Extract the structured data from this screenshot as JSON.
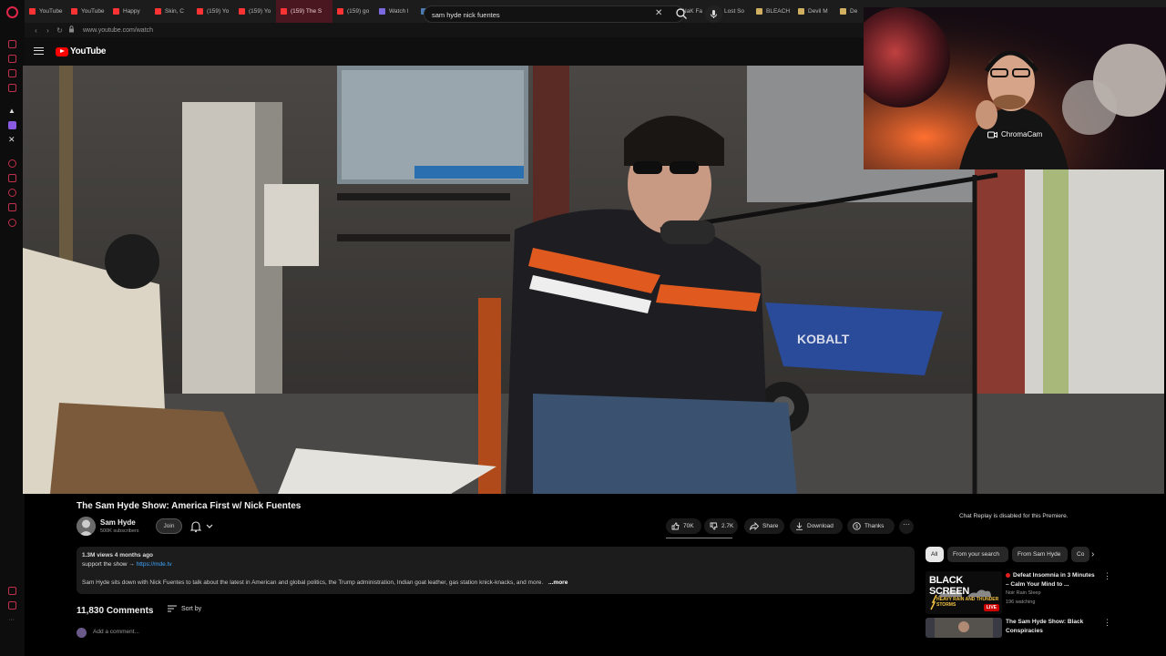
{
  "browser": {
    "tabs": [
      {
        "label": "YouTube",
        "color": "#ff3333"
      },
      {
        "label": "YouTube",
        "color": "#ff3333"
      },
      {
        "label": "Happy",
        "color": "#ff3333"
      },
      {
        "label": "Skin, C",
        "color": "#ff3333"
      },
      {
        "label": "(159) Yo",
        "color": "#ff3333"
      },
      {
        "label": "(159) Yo",
        "color": "#ff3333"
      },
      {
        "label": "(159) The S",
        "color": "#ff3333",
        "active": true
      },
      {
        "label": "(159) go",
        "color": "#ff3333"
      },
      {
        "label": "Watch l",
        "color": "#7a6adf"
      },
      {
        "label": "Steam C",
        "color": "#4a7ab0"
      },
      {
        "label": "electric",
        "color": "#cccccc"
      },
      {
        "label": "YouTube",
        "color": "#ff3333"
      },
      {
        "label": "Jill Mor",
        "color": "#d0b060"
      },
      {
        "label": "Wuchsr",
        "color": "#d0b060"
      },
      {
        "label": "NieR: A",
        "color": "#d0b060"
      },
      {
        "label": "NaK Fa",
        "color": "#d0b060"
      },
      {
        "label": "Lost So",
        "color": "#d0b060"
      },
      {
        "label": "BLEACH",
        "color": "#d0b060"
      },
      {
        "label": "Devil M",
        "color": "#d0b060"
      },
      {
        "label": "De",
        "color": "#d0b060"
      }
    ],
    "url": "www.youtube.com/watch"
  },
  "header": {
    "logo_text": "YouTube",
    "search_value": "sam hyde nick fuentes"
  },
  "webcam": {
    "label": "ChromaCam"
  },
  "video": {
    "title": "The Sam Hyde Show: America First w/ Nick Fuentes",
    "channel_name": "Sam Hyde",
    "subscribers": "500K subscribers",
    "join_label": "Join",
    "likes": "70K",
    "dislikes": "2.7K",
    "share_label": "Share",
    "download_label": "Download",
    "thanks_label": "Thanks"
  },
  "description": {
    "stats": "1.3M views  4 months ago",
    "support_prefix": "support the show → ",
    "support_link": "https://mde.tv",
    "text": "Sam Hyde sits down with Nick Fuentes to talk about the latest in American and global politics, the Trump administration, Indian goat leather, gas station knick-knacks, and more.",
    "more_label": "...more"
  },
  "comments": {
    "count": "11,830 Comments",
    "sort_label": "Sort by",
    "placeholder": "Add a comment..."
  },
  "sidebar_right": {
    "chat_replay": "Chat Replay is disabled for this Premiere.",
    "chips": [
      {
        "label": "All",
        "active": true
      },
      {
        "label": "From your search"
      },
      {
        "label": "From Sam Hyde"
      },
      {
        "label": "Co"
      }
    ],
    "recommendations": [
      {
        "title": "Defeat Insomnia in 3 Minutes – Calm Your Mind to ...",
        "channel": "Noir Rain Sleep",
        "meta": "196 watching",
        "thumb_title": "BLACK SCREEN",
        "thumb_sub": "HEAVY RAIN AND THUNDER STORMS",
        "badge": "LIVE",
        "live": true
      },
      {
        "title": "The Sam Hyde Show: Black Conspiracies"
      }
    ]
  },
  "colors": {
    "accent": "#ff0000",
    "opera": "#e0254a",
    "link": "#3ea6ff"
  }
}
